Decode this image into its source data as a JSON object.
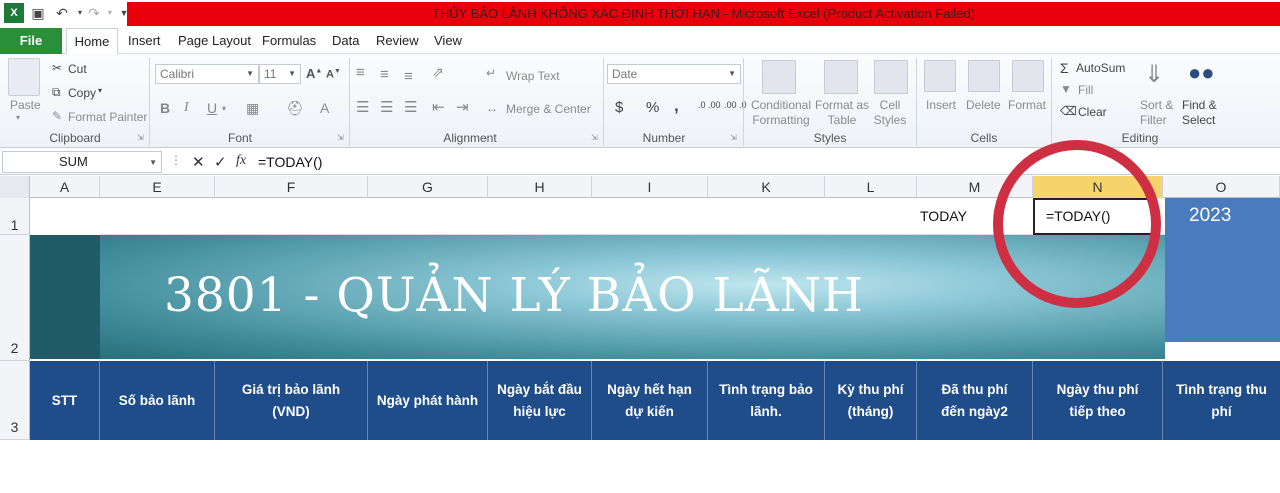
{
  "window": {
    "title": "THỦY BẢO LÃNH KHÔNG XÁC ĐỊNH THỜI HẠN  -  Microsoft Excel (Product Activation Failed)"
  },
  "ribbon_tabs": [
    "File",
    "Home",
    "Insert",
    "Page Layout",
    "Formulas",
    "Data",
    "Review",
    "View"
  ],
  "clipboard": {
    "paste": "Paste",
    "cut": "Cut",
    "copy": "Copy",
    "format_painter": "Format Painter",
    "label": "Clipboard"
  },
  "font": {
    "name": "Calibri",
    "size": "11",
    "label": "Font",
    "bold": "B",
    "italic": "I",
    "underline": "U"
  },
  "alignment": {
    "wrap_text": "Wrap Text",
    "merge_center": "Merge & Center",
    "label": "Alignment"
  },
  "number": {
    "format": "Date",
    "currency": "$",
    "percent": "%",
    "comma": ",",
    "label": "Number"
  },
  "styles": {
    "conditional": "Conditional Formatting",
    "format_table": "Format as Table",
    "cell_styles": "Cell Styles",
    "label": "Styles"
  },
  "cells": {
    "insert": "Insert",
    "delete": "Delete",
    "format": "Format",
    "label": "Cells"
  },
  "editing": {
    "autosum": "AutoSum",
    "fill": "Fill",
    "clear": "Clear",
    "sort_filter": "Sort & Filter",
    "find_select": "Find & Select",
    "label": "Editing"
  },
  "formula_bar": {
    "name_box": "SUM",
    "fx": "fx",
    "formula": "=TODAY()"
  },
  "columns": [
    "A",
    "E",
    "F",
    "G",
    "H",
    "I",
    "K",
    "L",
    "M",
    "N",
    "O"
  ],
  "rows": [
    "1",
    "2",
    "3"
  ],
  "row1": {
    "m_label": "TODAY",
    "n_value": "=TODAY()",
    "o_value": "2023"
  },
  "banner_title": "3801 - QUẢN LÝ BẢO LÃNH",
  "header_row": [
    "STT",
    "Số bảo lãnh",
    "Giá trị bảo lãnh (VND)",
    "Ngày phát hành",
    "Ngày bắt đầu hiệu lực",
    "Ngày hết hạn dự kiến",
    "Tình trạng bảo lãnh.",
    "Kỳ thu phí (tháng)",
    "Đã thu phí đến ngày2",
    "Ngày thu phí tiếp theo",
    "Tình trạng thu phí"
  ],
  "colors": {
    "file_tab": "#2b8f3a",
    "title_bar": "#e8000a",
    "header_fill": "#1e4d8a",
    "highlight_circle": "#cf2f43",
    "o1_fill": "#4a7bbf"
  }
}
